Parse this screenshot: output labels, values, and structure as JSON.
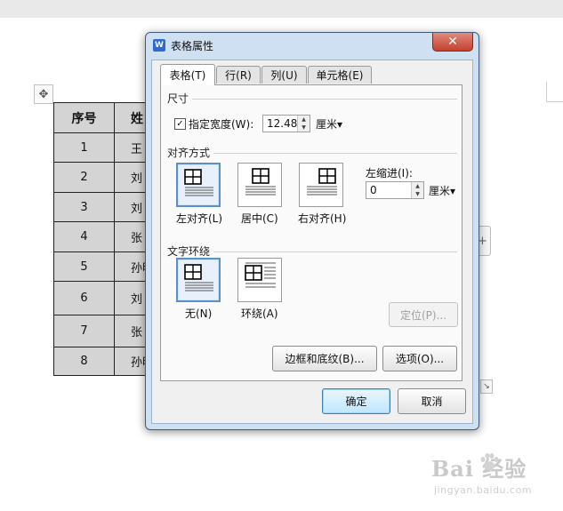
{
  "doc": {
    "move_handle_icon": "move-cross-icon",
    "table_headers": [
      "序号",
      "姓"
    ],
    "rows": [
      {
        "num": "1",
        "name": "王"
      },
      {
        "num": "2",
        "name": "刘"
      },
      {
        "num": "3",
        "name": "刘"
      },
      {
        "num": "4",
        "name": "张"
      },
      {
        "num": "5",
        "name": "孙明"
      },
      {
        "num": "6",
        "name": "刘"
      },
      {
        "num": "7",
        "name": "张"
      },
      {
        "num": "8",
        "name": "孙明"
      }
    ],
    "plus_label": "+",
    "resize_label": "↘"
  },
  "dialog": {
    "title": "表格属性",
    "app_icon_label": "W",
    "close_label": "✕",
    "tabs": [
      {
        "label": "表格(T)",
        "active": true
      },
      {
        "label": "行(R)",
        "active": false
      },
      {
        "label": "列(U)",
        "active": false
      },
      {
        "label": "单元格(E)",
        "active": false
      }
    ],
    "size": {
      "group_label": "尺寸",
      "width_checkbox_label": "指定宽度(W):",
      "width_checked": true,
      "width_value": "12.48",
      "unit": "厘米▾"
    },
    "alignment": {
      "group_label": "对齐方式",
      "options": [
        {
          "label": "左对齐(L)",
          "selected": true
        },
        {
          "label": "居中(C)",
          "selected": false
        },
        {
          "label": "右对齐(H)",
          "selected": false
        }
      ],
      "indent_label": "左缩进(I):",
      "indent_value": "0",
      "indent_unit": "厘米▾"
    },
    "wrap": {
      "group_label": "文字环绕",
      "options": [
        {
          "label": "无(N)",
          "selected": true
        },
        {
          "label": "环绕(A)",
          "selected": false
        }
      ],
      "position_button": "定位(P)..."
    },
    "borders_button": "边框和底纹(B)...",
    "options_button": "选项(O)...",
    "ok_button": "确定",
    "cancel_button": "取消"
  },
  "watermark": {
    "logo_text": "Bai 经验",
    "url": "jingyan.baidu.com"
  }
}
